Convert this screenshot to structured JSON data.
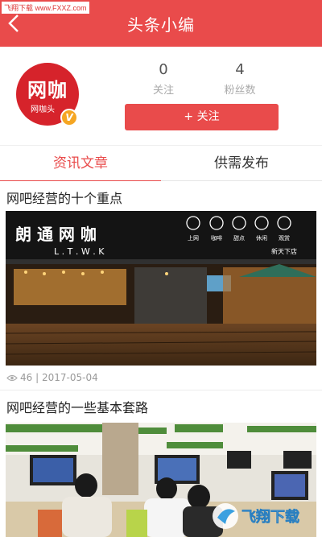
{
  "watermark": "飞翔下载 www.FXXZ.com",
  "header": {
    "title": "头条小编",
    "back_icon": "chevron-left-icon"
  },
  "profile": {
    "avatar_main": "网咖",
    "avatar_sub": "网咖头",
    "badge": "V",
    "stats": [
      {
        "value": "0",
        "label": "关注"
      },
      {
        "value": "4",
        "label": "粉丝数"
      }
    ],
    "follow_label": "+ 关注"
  },
  "tabs": [
    {
      "label": "资讯文章",
      "active": true
    },
    {
      "label": "供需发布",
      "active": false
    }
  ],
  "articles": [
    {
      "title": "网吧经营的十个重点",
      "views": "46",
      "date": "2017-05-04",
      "image_sign_text": "朗 通 网 咖",
      "image_sign_sub": "L . T . W . K",
      "image_sign_right": "新天下店",
      "image_menu": [
        "上网",
        "咖啡",
        "甜点",
        "休闲",
        "观赏"
      ]
    },
    {
      "title": "网吧经营的一些基本套路"
    }
  ],
  "site_logo": "飞翔下载",
  "colors": {
    "brand": "#e94b4b",
    "avatar": "#d6232b",
    "badge": "#f5a623"
  }
}
